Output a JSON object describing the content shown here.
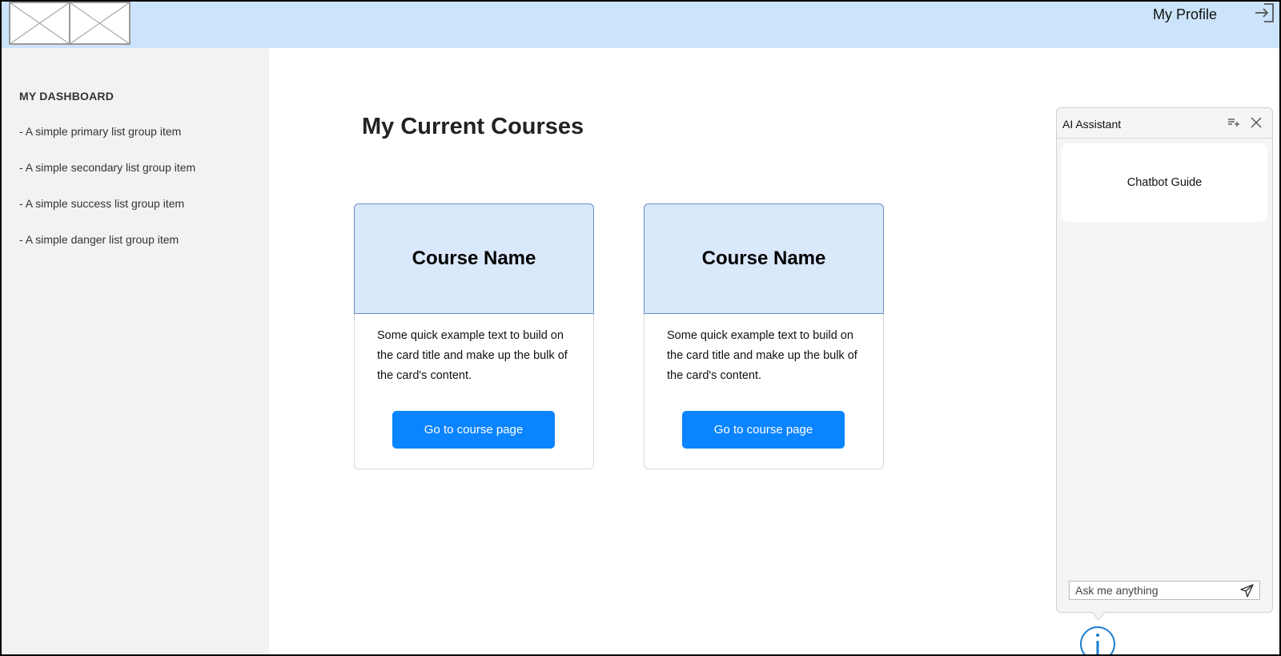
{
  "header": {
    "profile_label": "My Profile",
    "logout_icon": "logout-icon",
    "logo_icon": "image-placeholder-icon",
    "background": "#cce4fb"
  },
  "sidebar": {
    "title": "MY DASHBOARD",
    "items": [
      {
        "label": "- A simple primary list group item"
      },
      {
        "label": "- A simple secondary list group item"
      },
      {
        "label": "- A simple success list group item"
      },
      {
        "label": "- A simple danger list group item"
      }
    ]
  },
  "main": {
    "title": "My Current Courses",
    "cards": [
      {
        "title": "Course Name",
        "text": "Some quick example text to build on the card title and make up the bulk of the card's content.",
        "button_label": "Go to course page"
      },
      {
        "title": "Course Name",
        "text": "Some quick example text to build on the card title and make up the bulk of the card's content.",
        "button_label": "Go to course page"
      }
    ]
  },
  "ai_assistant": {
    "title": "AI Assistant",
    "guide_label": "Chatbot Guide",
    "input_placeholder": "Ask me anything",
    "icons": [
      "new-chat-icon",
      "close-icon",
      "send-icon",
      "info-icon"
    ]
  },
  "colors": {
    "accent": "#0a84ff",
    "card_header": "#dae8fc",
    "card_header_border": "#6c8ebf",
    "sidebar_bg": "#f2f2f2",
    "info_icon": "#1a7ccf"
  }
}
